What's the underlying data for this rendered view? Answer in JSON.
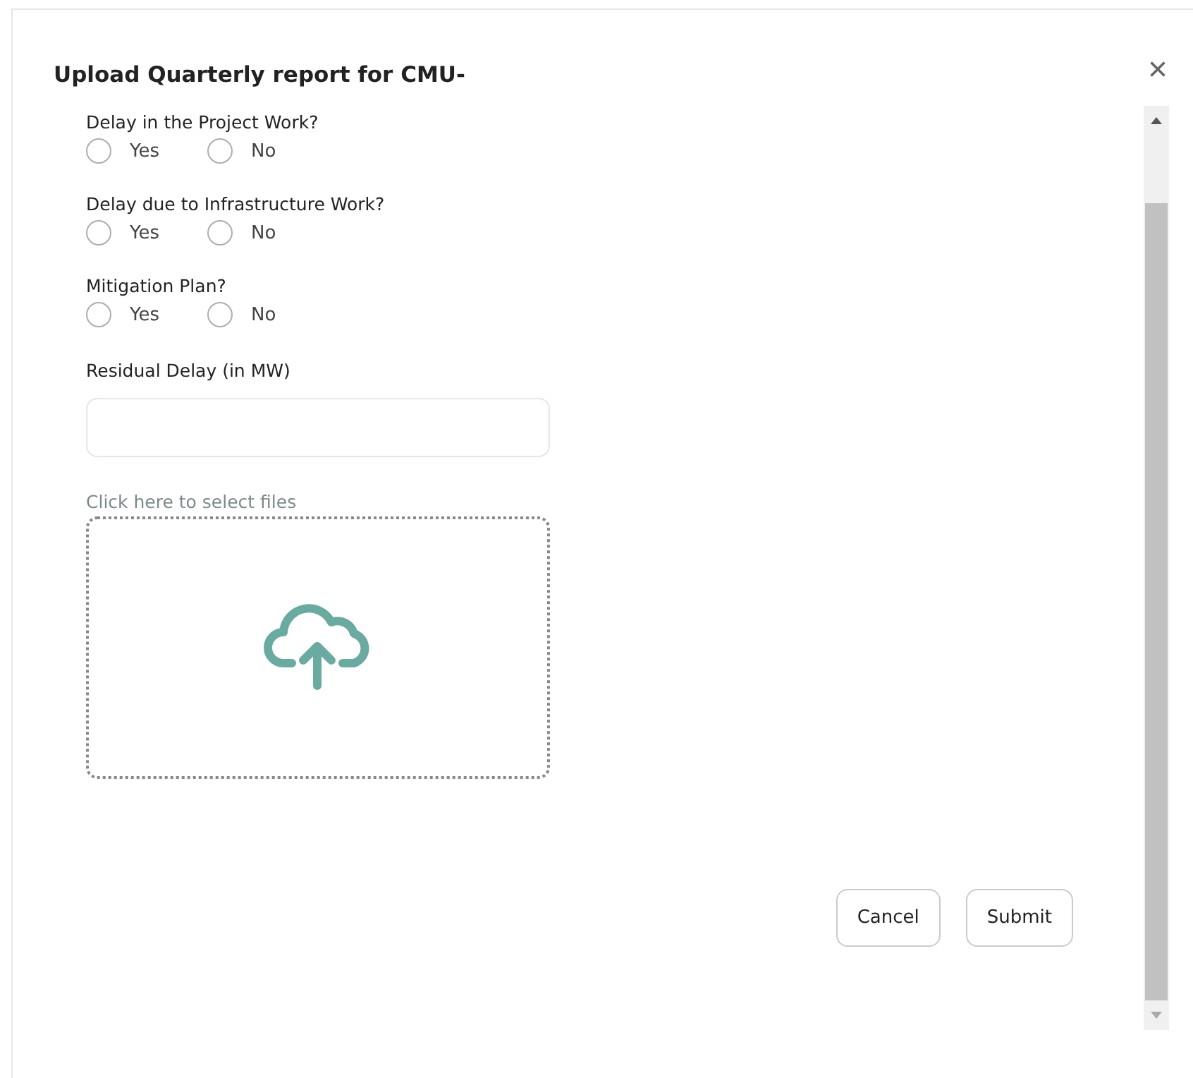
{
  "dialog": {
    "title": "Upload Quarterly report for CMU-",
    "close": "×"
  },
  "questions": [
    {
      "label": "Delay in the Project Work?",
      "options": [
        {
          "label": "Yes",
          "selected": false
        },
        {
          "label": "No",
          "selected": false
        }
      ]
    },
    {
      "label": "Delay due to Infrastructure Work?",
      "options": [
        {
          "label": "Yes",
          "selected": false
        },
        {
          "label": "No",
          "selected": false
        }
      ]
    },
    {
      "label": "Mitigation Plan?",
      "options": [
        {
          "label": "Yes",
          "selected": false
        },
        {
          "label": "No",
          "selected": false
        }
      ]
    }
  ],
  "residual_delay": {
    "label": "Residual Delay (in MW)"
  },
  "file_upload": {
    "label": "Click here to select files"
  },
  "buttons": [
    "Cancel",
    "Submit"
  ]
}
